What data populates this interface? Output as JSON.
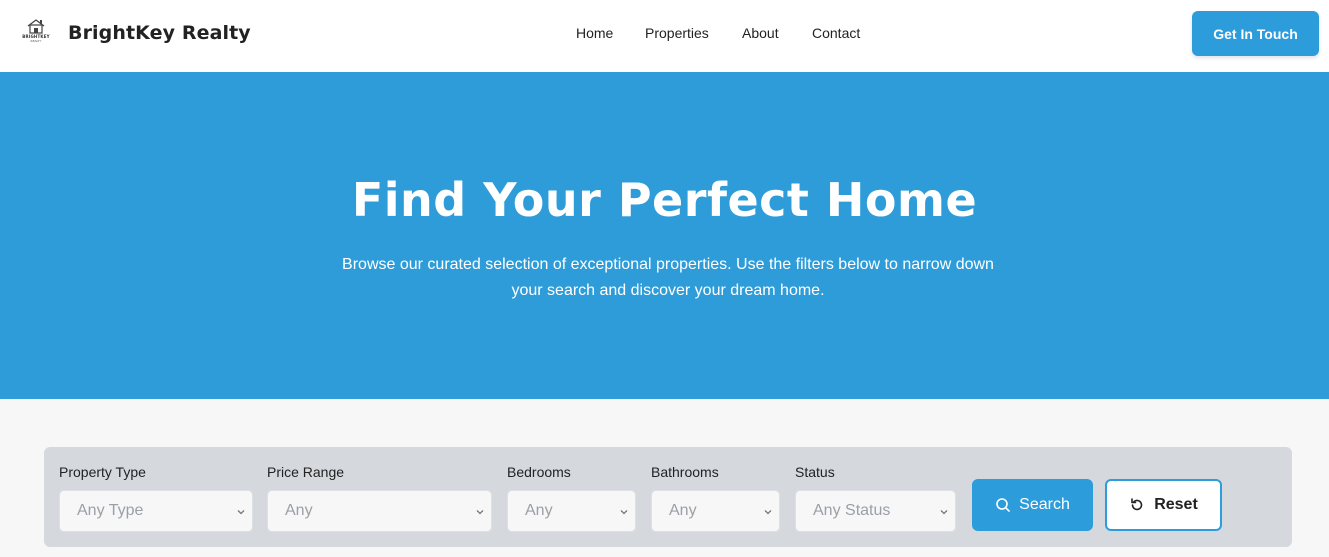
{
  "header": {
    "logo_word": "BRIGHTKEY",
    "logo_sub": "REALTY",
    "brand": "BrightKey Realty",
    "nav": [
      "Home",
      "Properties",
      "About",
      "Contact"
    ],
    "cta": "Get In Touch"
  },
  "hero": {
    "title": "Find Your Perfect Home",
    "subtitle": "Browse our curated selection of exceptional properties. Use the filters below to narrow down your search and discover your dream home."
  },
  "filters": {
    "property_type": {
      "label": "Property Type",
      "value": "Any Type"
    },
    "price_range": {
      "label": "Price Range",
      "value": "Any"
    },
    "bedrooms": {
      "label": "Bedrooms",
      "value": "Any"
    },
    "bathrooms": {
      "label": "Bathrooms",
      "value": "Any"
    },
    "status": {
      "label": "Status",
      "value": "Any Status"
    },
    "search_label": "Search",
    "reset_label": "Reset"
  },
  "colors": {
    "accent": "#2d9cdb",
    "hero_bg": "#2d9cd9",
    "filter_bg": "#d5d9de"
  },
  "icons": {
    "search": "search-icon",
    "reset": "reset-icon",
    "chevron": "chevron-down-icon",
    "logo": "house-logo-icon"
  }
}
